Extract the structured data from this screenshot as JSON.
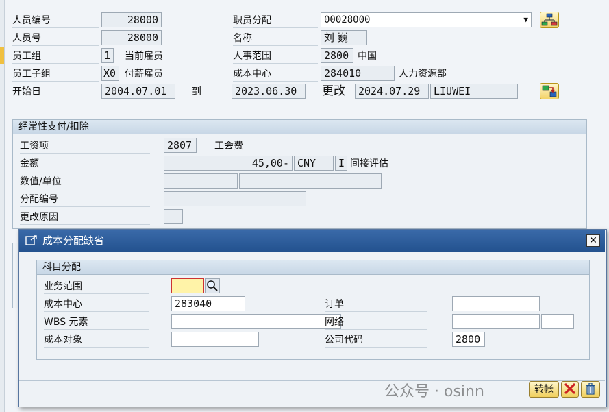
{
  "header": {
    "personnel_no_label": "人员编号",
    "personnel_no_value": "28000",
    "person_id_label": "人员号",
    "person_id_value": "28000",
    "emp_group_label": "员工组",
    "emp_group_code": "1",
    "emp_group_text": "当前雇员",
    "emp_subgroup_label": "员工子组",
    "emp_subgroup_code": "X0",
    "emp_subgroup_text": "付薪雇员",
    "start_label": "开始日",
    "start_value": "2004.07.01",
    "to_label": "到",
    "end_value": "2023.06.30",
    "changed_label": "更改",
    "changed_date": "2024.07.29",
    "changed_user": "LIUWEI",
    "assignment_label": "职员分配",
    "assignment_value": "00028000",
    "name_label": "名称",
    "name_value": "刘 巍",
    "pers_area_label": "人事范围",
    "pers_area_code": "2800",
    "pers_area_text": "中国",
    "cost_center_label": "成本中心",
    "cost_center_code": "284010",
    "cost_center_text": "人力资源部"
  },
  "recurring": {
    "title": "经常性支付/扣除",
    "wage_type_label": "工资项",
    "wage_type_code": "2807",
    "wage_type_text": "工会费",
    "amount_label": "金额",
    "amount_value": "45,00-",
    "currency": "CNY",
    "indicator": "I",
    "indicator_text": "间接评估",
    "number_unit_label": "数值/单位",
    "assignment_no_label": "分配编号",
    "reason_label": "更改原因"
  },
  "dialog": {
    "title": "成本分配缺省",
    "close_glyph": "✕",
    "section_title": "科目分配",
    "business_area_label": "业务范围",
    "business_area_value": "",
    "cost_center_label": "成本中心",
    "cost_center_value": "283040",
    "wbs_label": "WBS 元素",
    "wbs_value": "",
    "cost_object_label": "成本对象",
    "cost_object_value": "",
    "order_label": "订单",
    "order_value": "",
    "network_label": "网络",
    "network_value": "",
    "company_code_label": "公司代码",
    "company_code_value": "2800",
    "transfer_label": "转帐",
    "watermark": "公众号 · osinn"
  },
  "icons": {
    "search": "search-icon",
    "org_structure": "org-structure-icon",
    "change_history": "change-history-icon",
    "cancel": "cancel-icon",
    "delete": "delete-icon"
  },
  "colors": {
    "title_bar": "#2d5f9e",
    "field_bg": "#e8edf2",
    "input_bg": "#ffffff",
    "focus_bg": "#fff3a8",
    "button_gold": "#f0cf5c",
    "cancel_red": "#cc2222"
  }
}
